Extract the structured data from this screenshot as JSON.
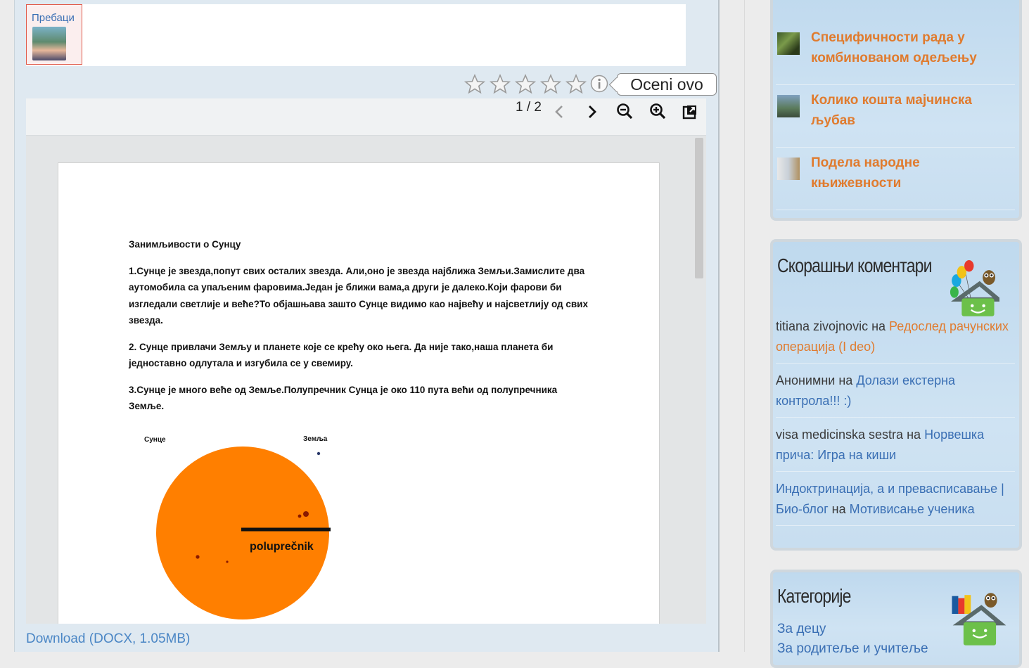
{
  "share": {
    "label": "Пребаци"
  },
  "rating": {
    "tooltip": "Oceni ovo",
    "stars": 0,
    "max_stars": 5
  },
  "viewer": {
    "page_indicator": "1 / 2",
    "tools": [
      "prev-page-icon",
      "next-page-icon",
      "zoom-out-icon",
      "zoom-in-icon",
      "popout-icon"
    ]
  },
  "document": {
    "title": "Занимљивости о  Сунцу",
    "paragraphs": [
      "1.Сунце је звезда,попут свих осталих звезда. Али,оно је звезда најближа Земљи.Замислите два аутомобила са упаљеним фаровима.Један је ближи вама,а други је далеко.Који фарови би изгледали светлије и веће?То објашњава зашто Сунце видимо као највећу и најсветлију од свих звезда.",
      "2. Сунце привлачи Земљу и планете које се крећу око њега. Да није тако,наша планета би једноставно одлутала и изгубила се у свемиру.",
      "3.Сунце је много веће од Земље.Полупречник Сунца је око 110 пута већи од полупречника Земље."
    ],
    "figure": {
      "sun_label": "Сунце",
      "earth_label": "Земља",
      "radius_label": "poluprečnik",
      "sun_color": "#ff7f00"
    }
  },
  "download": {
    "label": "Download (DOCX, 1.05MB)"
  },
  "sidebar": {
    "posts": [
      {
        "title": "Специфичности рада у комбинованом одељењу"
      },
      {
        "title": "Колико кошта мајчинска љубав"
      },
      {
        "title": "Подела народне књижевности"
      }
    ],
    "comments": {
      "title": "Скорашњи коментари",
      "items": [
        {
          "author": "titiana zivojnovic",
          "on": "на",
          "post": "Редослед рачунских операција (I deo)"
        },
        {
          "author": "Анонимни",
          "on": "на",
          "post": "Долази екстерна контрола!!! :)"
        },
        {
          "author": "visa medicinska sestra",
          "on": "на",
          "post": "Норвешка прича: Игра на киши"
        },
        {
          "author": "Индоктринација, а и превасписавање | Био-блог",
          "on": "на",
          "post": "Мотивисање ученика"
        }
      ]
    },
    "categories": {
      "title": "Категорије",
      "items": [
        "За децу",
        "За родитеље и учитеље"
      ]
    }
  },
  "colors": {
    "accent_orange": "#e07b2e",
    "link_blue": "#3a6fb4",
    "panel_blue": "#dfe9f1"
  }
}
